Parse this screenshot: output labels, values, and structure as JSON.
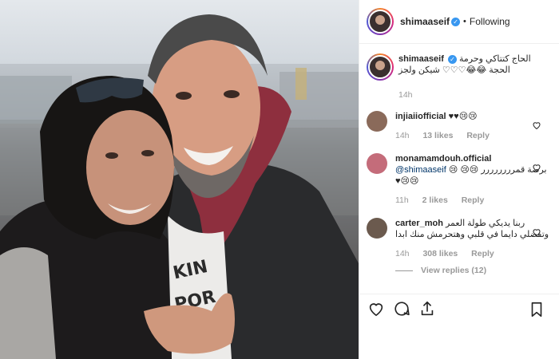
{
  "post": {
    "username": "shimaaseif",
    "follow_status": "Following",
    "separator": "•",
    "verified": true
  },
  "caption": {
    "username": "shimaaseif",
    "text": "الحاج كتتاكي وحرمة الحجة 😂😂♡♡♡ شيكن ولجز",
    "time": "14h"
  },
  "comments": [
    {
      "username": "injiaiiofficial",
      "text": "♥♥😢😢",
      "time": "14h",
      "likes": "13 likes",
      "reply": "Reply"
    },
    {
      "username": "monamamdouh.official",
      "mention": "@shimaaseif",
      "text": "برضة قمرررررررر 😢😢 😢😢😢♥",
      "time": "11h",
      "likes": "2 likes",
      "reply": "Reply"
    },
    {
      "username": "carter_moh",
      "text": "ربنا يديكي طولة العمر وتفضلي دايما في قلبي وهتحرمش منك ابدا",
      "time": "14h",
      "likes": "308 likes",
      "reply": "Reply",
      "view_replies": "View replies (12)"
    }
  ],
  "icons": {
    "like": "heart-icon",
    "comment": "comment-icon",
    "share": "share-icon",
    "save": "bookmark-icon"
  },
  "colors": {
    "verified": "#3897f0",
    "muted": "#999999",
    "text": "#262626",
    "border": "#efefef"
  }
}
